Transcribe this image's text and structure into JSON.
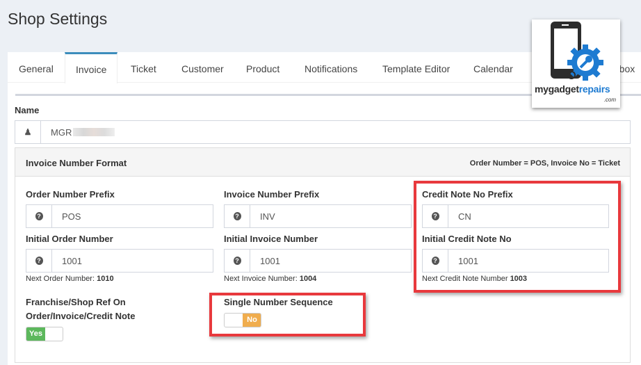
{
  "page_title": "Shop Settings",
  "tabs": [
    {
      "label": "General"
    },
    {
      "label": "Invoice",
      "active": true
    },
    {
      "label": "Ticket"
    },
    {
      "label": "Customer"
    },
    {
      "label": "Product"
    },
    {
      "label": "Notifications"
    },
    {
      "label": "Template Editor"
    },
    {
      "label": "Calendar"
    },
    {
      "label": "Toolbox"
    }
  ],
  "name": {
    "label": "Name",
    "value": "MGR"
  },
  "panel": {
    "title": "Invoice Number Format",
    "hint": "Order Number = POS, Invoice No = Ticket"
  },
  "fields": {
    "order_prefix": {
      "label": "Order Number Prefix",
      "value": "POS"
    },
    "invoice_prefix": {
      "label": "Invoice Number Prefix",
      "value": "INV"
    },
    "credit_prefix": {
      "label": "Credit Note No Prefix",
      "value": "CN"
    },
    "order_initial": {
      "label": "Initial Order Number",
      "value": "1001",
      "next_label": "Next Order Number:",
      "next": "1010"
    },
    "invoice_initial": {
      "label": "Initial Invoice Number",
      "value": "1001",
      "next_label": "Next Invoice Number:",
      "next": "1004"
    },
    "credit_initial": {
      "label": "Initial Credit Note No",
      "value": "1001",
      "next_label": "Next Credit Note Number",
      "next": "1003"
    }
  },
  "franchise": {
    "label_line1": "Franchise/Shop Ref On",
    "label_line2": "Order/Invoice/Credit Note",
    "toggle": "Yes",
    "on": true
  },
  "single_sequence": {
    "label": "Single Number Sequence",
    "toggle": "No",
    "on": false
  },
  "logo": {
    "text_a": "mygadget",
    "text_b": "repairs",
    "text_c": ".com"
  },
  "colors": {
    "accent": "#3c8dbc",
    "yes": "#5cb85c",
    "no": "#f0ad4e",
    "highlight": "#e8393d"
  }
}
